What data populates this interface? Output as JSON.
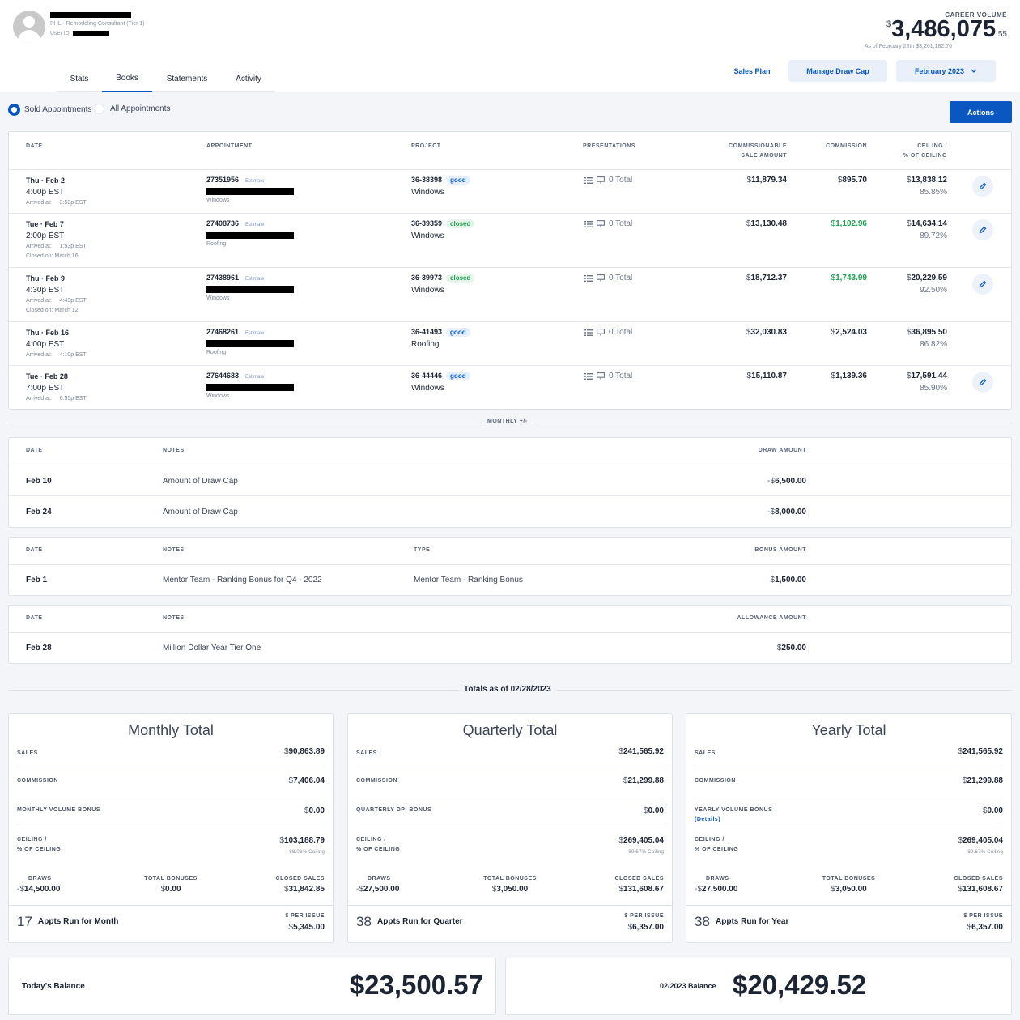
{
  "header": {
    "subtitle": "PHL · Remodeling Consultant (Tier 1)",
    "user_id_label": "User ID",
    "career_label": "CAREER VOLUME",
    "career_currency": "$",
    "career_value": "3,486,075",
    "career_cents": ".55",
    "career_asof": "As of February 28th $3,261,182.76",
    "tabs": [
      "Stats",
      "Books",
      "Statements",
      "Activity"
    ],
    "active_tab": "Books",
    "sales_plan": "Sales Plan",
    "manage_draw_cap": "Manage Draw Cap",
    "period": "February 2023"
  },
  "filters": {
    "sold": "Sold Appointments",
    "all": "All Appointments",
    "actions": "Actions"
  },
  "appointments": {
    "headers": {
      "date": "DATE",
      "appointment": "APPOINTMENT",
      "project": "PROJECT",
      "presentations": "PRESENTATIONS",
      "commissionable1": "COMMISSIONABLE",
      "commissionable2": "SALE AMOUNT",
      "commission": "COMMISSION",
      "ceiling1": "CEILING /",
      "ceiling2": "% OF CEILING"
    },
    "rows": [
      {
        "day": "Thu · Feb 2",
        "time": "4:00p",
        "tz": "EST",
        "arrived_label": "Arrived at:",
        "arrived": "3:53p EST",
        "closed_on": "",
        "appt_id": "27351956",
        "appt_tag": "Estimate",
        "appt_type": "Windows",
        "project_id": "36-38398",
        "project_status": "good",
        "project_type": "Windows",
        "presentations": "0 Total",
        "sale_amount": "11,879.34",
        "commission": "895.70",
        "commission_green": false,
        "ceiling": "13,838.12",
        "ceiling_pct": "85.85%",
        "editable": true
      },
      {
        "day": "Tue · Feb 7",
        "time": "2:00p",
        "tz": "EST",
        "arrived_label": "Arrived at:",
        "arrived": "1:53p EST",
        "closed_on": "Closed on: March 16",
        "appt_id": "27408736",
        "appt_tag": "Estimate",
        "appt_type": "Roofing",
        "project_id": "36-39359",
        "project_status": "closed",
        "project_type": "Windows",
        "presentations": "0 Total",
        "sale_amount": "13,130.48",
        "commission": "1,102.96",
        "commission_green": true,
        "ceiling": "14,634.14",
        "ceiling_pct": "89.72%",
        "editable": true
      },
      {
        "day": "Thu · Feb 9",
        "time": "4:30p",
        "tz": "EST",
        "arrived_label": "Arrived at:",
        "arrived": "4:43p EST",
        "closed_on": "Closed on: March 12",
        "appt_id": "27438961",
        "appt_tag": "Estimate",
        "appt_type": "Windows",
        "project_id": "36-39973",
        "project_status": "closed",
        "project_type": "Windows",
        "presentations": "0 Total",
        "sale_amount": "18,712.37",
        "commission": "1,743.99",
        "commission_green": true,
        "ceiling": "20,229.59",
        "ceiling_pct": "92.50%",
        "editable": true
      },
      {
        "day": "Thu · Feb 16",
        "time": "4:00p",
        "tz": "EST",
        "arrived_label": "Arrived at:",
        "arrived": "4:10p EST",
        "closed_on": "",
        "appt_id": "27468261",
        "appt_tag": "Estimate",
        "appt_type": "Roofing",
        "project_id": "36-41493",
        "project_status": "good",
        "project_type": "Roofing",
        "presentations": "0 Total",
        "sale_amount": "32,030.83",
        "commission": "2,524.03",
        "commission_green": false,
        "ceiling": "36,895.50",
        "ceiling_pct": "86.82%",
        "editable": false
      },
      {
        "day": "Tue · Feb 28",
        "time": "7:00p",
        "tz": "EST",
        "arrived_label": "Arrived at:",
        "arrived": "6:55p EST",
        "closed_on": "",
        "appt_id": "27644683",
        "appt_tag": "Estimate",
        "appt_type": "Windows",
        "project_id": "36-44446",
        "project_status": "good",
        "project_type": "Windows",
        "presentations": "0 Total",
        "sale_amount": "15,110.87",
        "commission": "1,139.36",
        "commission_green": false,
        "ceiling": "17,591.44",
        "ceiling_pct": "85.90%",
        "editable": true
      }
    ]
  },
  "monthly_label": "MONTHLY +/-",
  "draws": {
    "headers": {
      "date": "DATE",
      "notes": "NOTES",
      "amount": "DRAW AMOUNT"
    },
    "rows": [
      {
        "date": "Feb 10",
        "notes": "Amount of Draw Cap",
        "sign": "-$",
        "amount": "6,500.00"
      },
      {
        "date": "Feb 24",
        "notes": "Amount of Draw Cap",
        "sign": "-$",
        "amount": "8,000.00"
      }
    ]
  },
  "bonuses": {
    "headers": {
      "date": "DATE",
      "notes": "NOTES",
      "type": "TYPE",
      "amount": "BONUS AMOUNT"
    },
    "rows": [
      {
        "date": "Feb 1",
        "notes": "Mentor Team - Ranking Bonus for Q4 - 2022",
        "type": "Mentor Team - Ranking Bonus",
        "sign": "$",
        "amount": "1,500.00"
      }
    ]
  },
  "allowances": {
    "headers": {
      "date": "DATE",
      "notes": "NOTES",
      "amount": "ALLOWANCE AMOUNT"
    },
    "rows": [
      {
        "date": "Feb 28",
        "notes": "Million Dollar Year Tier One",
        "sign": "$",
        "amount": "250.00"
      }
    ]
  },
  "totals_label": "Totals as of 02/28/2023",
  "totals": [
    {
      "title": "Monthly Total",
      "sales_label": "SALES",
      "sales": "90,863.89",
      "commission_label": "COMMISSION",
      "commission": "7,406.04",
      "bonus_label": "MONTHLY VOLUME BONUS",
      "bonus_details": "",
      "bonus": "0.00",
      "ceiling_label1": "CEILING /",
      "ceiling_label2": "% OF CEILING",
      "ceiling": "103,188.79",
      "ceiling_pct": "88.06% Ceiling",
      "draws_label": "DRAWS",
      "draws": "14,500.00",
      "total_bonuses_label": "TOTAL BONUSES",
      "total_bonuses": "0.00",
      "closed_sales_label": "CLOSED SALES",
      "closed_sales": "31,842.85",
      "appts_count": "17",
      "appts_label": "Appts Run for Month",
      "per_issue_label": "$ PER ISSUE",
      "per_issue": "5,345.00"
    },
    {
      "title": "Quarterly Total",
      "sales_label": "SALES",
      "sales": "241,565.92",
      "commission_label": "COMMISSION",
      "commission": "21,299.88",
      "bonus_label": "QUARTERLY DPI BONUS",
      "bonus_details": "",
      "bonus": "0.00",
      "ceiling_label1": "CEILING /",
      "ceiling_label2": "% OF CEILING",
      "ceiling": "269,405.04",
      "ceiling_pct": "89.67% Ceiling",
      "draws_label": "DRAWS",
      "draws": "27,500.00",
      "total_bonuses_label": "TOTAL BONUSES",
      "total_bonuses": "3,050.00",
      "closed_sales_label": "CLOSED SALES",
      "closed_sales": "131,608.67",
      "appts_count": "38",
      "appts_label": "Appts Run for Quarter",
      "per_issue_label": "$ PER ISSUE",
      "per_issue": "6,357.00"
    },
    {
      "title": "Yearly Total",
      "sales_label": "SALES",
      "sales": "241,565.92",
      "commission_label": "COMMISSION",
      "commission": "21,299.88",
      "bonus_label": "YEARLY VOLUME BONUS",
      "bonus_details": "(Details)",
      "bonus": "0.00",
      "ceiling_label1": "CEILING /",
      "ceiling_label2": "% OF CEILING",
      "ceiling": "269,405.04",
      "ceiling_pct": "89.67% Ceiling",
      "draws_label": "DRAWS",
      "draws": "27,500.00",
      "total_bonuses_label": "TOTAL BONUSES",
      "total_bonuses": "3,050.00",
      "closed_sales_label": "CLOSED SALES",
      "closed_sales": "131,608.67",
      "appts_count": "38",
      "appts_label": "Appts Run for Year",
      "per_issue_label": "$ PER ISSUE",
      "per_issue": "6,357.00"
    }
  ],
  "balances": {
    "today_label": "Today's Balance",
    "today_value": "$23,500.57",
    "period_label": "02/2023 Balance",
    "period_value": "$20,429.52"
  },
  "colors": {
    "accent": "#0a57c2",
    "green": "#1e9f4e",
    "page_bg": "#f3f5f9"
  },
  "icons": {
    "edit": "pencil-icon",
    "list": "list-icon",
    "presentation": "presentation-icon",
    "period": "chevron-down-icon"
  }
}
